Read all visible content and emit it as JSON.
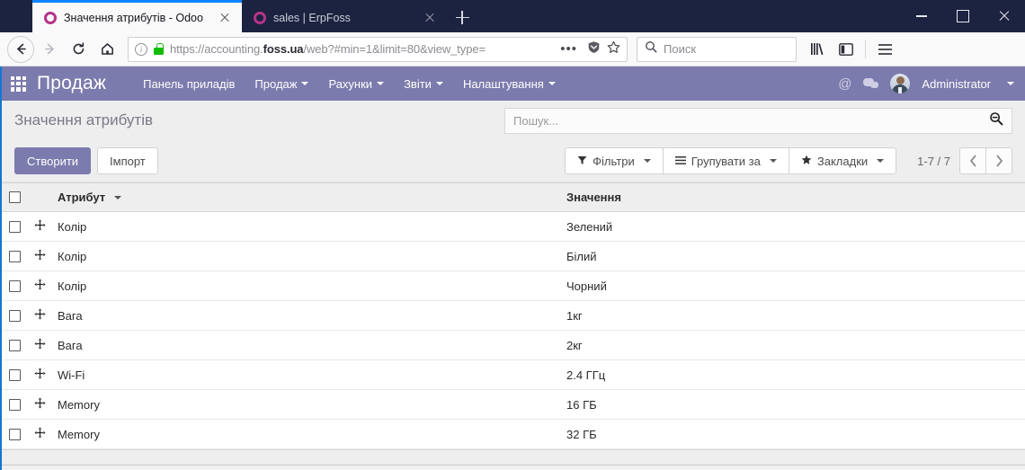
{
  "browser": {
    "tabs": [
      {
        "title": "Значення атрибутів - Odoo",
        "favicon": "odoo-ring-icon",
        "active": true,
        "close_label": "×"
      },
      {
        "title": "sales | ErpFoss",
        "favicon": "odoo-ring-icon",
        "active": false,
        "close_label": "×"
      }
    ],
    "new_tab_label": "+",
    "window_controls": {
      "minimize": "—",
      "maximize": "□",
      "close": "✕"
    },
    "nav": {
      "back": "back-icon",
      "forward": "forward-icon",
      "reload": "reload-icon",
      "home": "home-icon"
    },
    "url": {
      "prefix": "https://accounting.",
      "domain": "foss.ua",
      "suffix": "/web?#min=1&limit=80&view_type=",
      "full": "https://accounting.foss.ua/web?#min=1&limit=80&view_type=",
      "info_glyph": "i",
      "lock": "padlock-icon",
      "page_actions": "•••",
      "pocket": "pocket-icon",
      "bookmark": "★"
    },
    "search": {
      "placeholder": "Поиск",
      "icon": "search-icon"
    },
    "toolbar_icons": {
      "library": "library-icon",
      "sidebar": "sidebar-icon",
      "menu": "hamburger-menu-icon"
    }
  },
  "odoo": {
    "apps_icon": "apps-grid-icon",
    "brand": "Продаж",
    "menu": [
      {
        "label": "Панель приладів",
        "has_caret": false
      },
      {
        "label": "Продаж",
        "has_caret": true
      },
      {
        "label": "Рахунки",
        "has_caret": true
      },
      {
        "label": "Звіти",
        "has_caret": true
      },
      {
        "label": "Налаштування",
        "has_caret": true
      }
    ],
    "right": {
      "mention_icon": "at-sign-icon",
      "messages_icon": "chat-bubble-icon",
      "avatar": "user-avatar",
      "user": "Administrator"
    },
    "control_panel": {
      "title": "Значення атрибутів",
      "search_placeholder": "Пошук...",
      "search_icon": "magnifier-minus-icon",
      "create_label": "Створити",
      "import_label": "Імпорт",
      "filters": [
        {
          "label": "Фільтри",
          "icon": "funnel-icon",
          "caret": true
        },
        {
          "label": "Групувати за",
          "icon": "list-lines-icon",
          "caret": true
        },
        {
          "label": "Закладки",
          "icon": "star-icon",
          "caret": true
        }
      ],
      "pager": {
        "label": "1-7 / 7",
        "prev": "‹",
        "next": "›"
      }
    },
    "table": {
      "select_all": "select-all-checkbox",
      "columns": [
        {
          "label": "Атрибут",
          "sorted": true,
          "sort_caret": "▾"
        },
        {
          "label": "Значення",
          "sorted": false
        }
      ],
      "rows": [
        {
          "attribute": "Колір",
          "value": "Зелений"
        },
        {
          "attribute": "Колір",
          "value": "Білий"
        },
        {
          "attribute": "Колір",
          "value": "Чорний"
        },
        {
          "attribute": "Вага",
          "value": "1кг"
        },
        {
          "attribute": "Вага",
          "value": "2кг"
        },
        {
          "attribute": "Wi-Fi",
          "value": "2.4 ГГц"
        },
        {
          "attribute": "Memory",
          "value": "16 ГБ"
        },
        {
          "attribute": "Memory",
          "value": "32 ГБ"
        }
      ]
    }
  },
  "colors": {
    "titlebar": "#1c2340",
    "odoo_purple": "#7c7bad",
    "tab_accent": "#0a84ff",
    "favicon": "#b5338a",
    "lock_green": "#12bc00"
  }
}
